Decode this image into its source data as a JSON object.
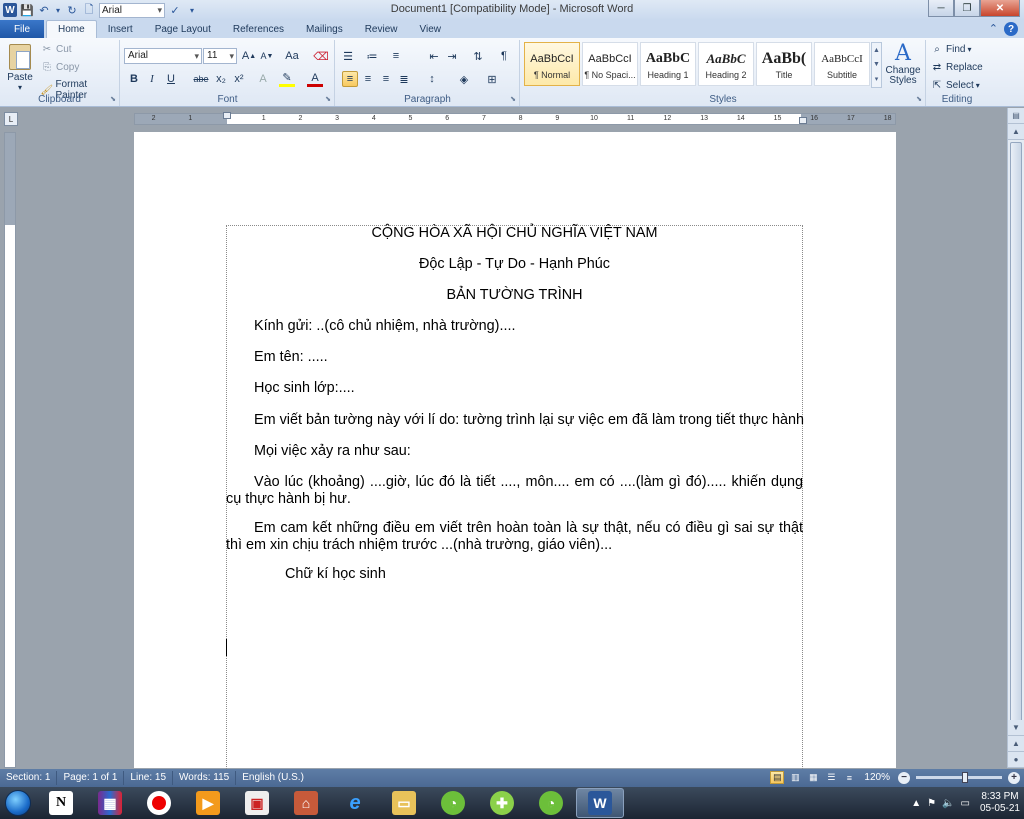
{
  "window": {
    "title": "Document1 [Compatibility Mode] - Microsoft Word",
    "qat_font": "Arial"
  },
  "tabs": [
    "File",
    "Home",
    "Insert",
    "Page Layout",
    "References",
    "Mailings",
    "Review",
    "View"
  ],
  "active_tab": "Home",
  "ribbon": {
    "clipboard": {
      "label": "Clipboard",
      "paste": "Paste",
      "cut": "Cut",
      "copy": "Copy",
      "format_painter": "Format Painter"
    },
    "font": {
      "label": "Font",
      "name": "Arial",
      "size": "11",
      "change_case": "Aa",
      "bold": "B",
      "italic": "I",
      "underline": "U",
      "strikethrough": "abe",
      "subscript": "x₂",
      "superscript": "x²"
    },
    "paragraph": {
      "label": "Paragraph"
    },
    "styles": {
      "label": "Styles",
      "items": [
        {
          "sample": "AaBbCcI",
          "name": "¶ Normal"
        },
        {
          "sample": "AaBbCcI",
          "name": "¶ No Spaci..."
        },
        {
          "sample": "AaBbC",
          "name": "Heading 1"
        },
        {
          "sample": "AaBbC",
          "name": "Heading 2"
        },
        {
          "sample": "AaBb(",
          "name": "Title"
        },
        {
          "sample": "AaBbCcI",
          "name": "Subtitle"
        }
      ],
      "change_styles": "Change Styles"
    },
    "editing": {
      "label": "Editing",
      "find": "Find",
      "replace": "Replace",
      "select": "Select"
    }
  },
  "ruler": {
    "ticks": [
      "2",
      "1",
      "1",
      "2",
      "3",
      "4",
      "5",
      "6",
      "7",
      "8",
      "9",
      "10",
      "11",
      "12",
      "13",
      "14",
      "15",
      "16",
      "17",
      "18"
    ]
  },
  "document": {
    "line1": "CỘNG HÒA XÃ HỘI CHỦ NGHĨA VIỆT NAM",
    "line2": "Độc Lập - Tự Do - Hạnh Phúc",
    "line3": "BẢN TƯỜNG TRÌNH",
    "p1": "Kính gửi: ..(cô chủ nhiệm, nhà trường)....",
    "p2": "Em tên: .....",
    "p3": "Học sinh lớp:....",
    "p4": "Em viết bản tường này với lí do: tường trình lại sự việc em đã làm trong tiết thực hành",
    "p5": "Mọi việc xảy ra như sau:",
    "p6": "Vào lúc (khoảng) ....giờ, lúc đó là tiết ...., môn.... em có ....(làm gì đó)..... khiến dụng cụ thực hành bị hư.",
    "p7": "Em cam kết những điều em viết trên hoàn toàn là sự thật, nếu có điều gì sai sự thật thì em xin chịu trách nhiệm trước ...(nhà trường, giáo viên)...",
    "p8": "Chữ kí học sinh"
  },
  "status": {
    "section": "Section: 1",
    "page": "Page: 1 of 1",
    "line": "Line: 15",
    "words": "Words: 115",
    "language": "English (U.S.)",
    "zoom": "120%"
  },
  "taskbar": {
    "time": "8:33 PM",
    "date": "05-05-21"
  }
}
